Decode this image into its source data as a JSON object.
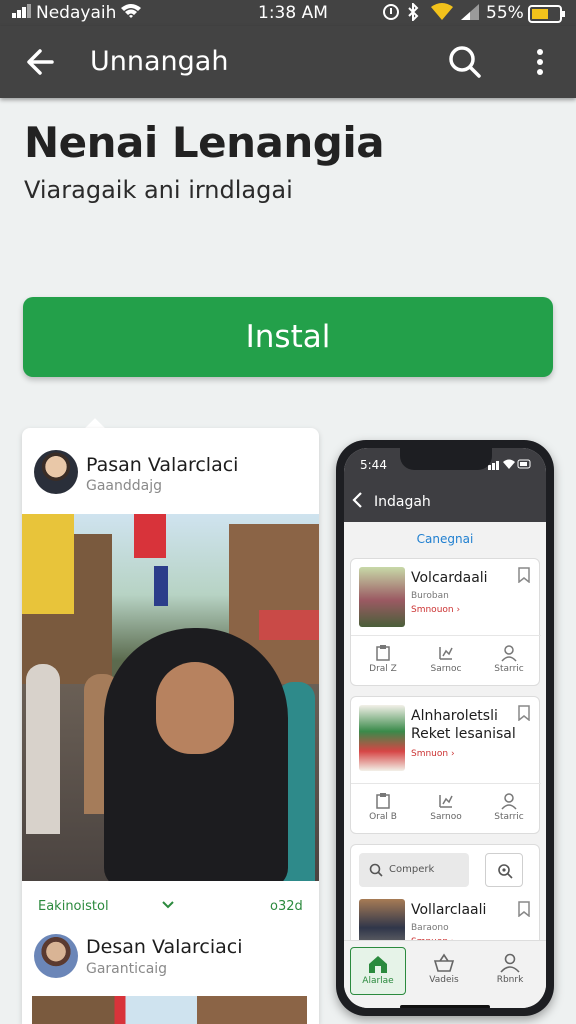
{
  "status_bar": {
    "carrier": "Nedayaih",
    "time": "1:38 AM",
    "battery": "55%"
  },
  "app_bar": {
    "title": "Unnangah",
    "icons": [
      "back-arrow-icon",
      "search-icon",
      "more-vert-icon"
    ]
  },
  "hero": {
    "title": "Nenai Lenangia",
    "subtitle": "Viaragaik ani irndlagai"
  },
  "install_button": {
    "label": "Instal",
    "color": "#23a04a"
  },
  "feed": {
    "posts": [
      {
        "name": "Pasan Valarclaci",
        "handle": "Gaanddajg"
      },
      {
        "name": "Desan Valarciaci",
        "handle": "Garanticaig"
      }
    ],
    "meta": {
      "left": "Eakinoistol",
      "right": "o32d"
    }
  },
  "phone": {
    "time": "5:44",
    "title": "Indagah",
    "category": "Canegnai",
    "cards": [
      {
        "title": "Volcardaali",
        "subtitle": "Buroban",
        "link": "Smnouon ›",
        "actions": [
          "Dral Z",
          "Sarnoc",
          "Starric"
        ]
      },
      {
        "title": "Alnharoletsli Reket lesanisal",
        "subtitle": "",
        "link": "Smnuon ›",
        "actions": [
          "Oral B",
          "Sarnoo",
          "Starric"
        ]
      },
      {
        "title": "Vollarclaali",
        "subtitle": "Baraono",
        "link": "Smnuon ›"
      }
    ],
    "search_label": "Comperk",
    "nav": [
      "Alarlae",
      "Vadeis",
      "Rbnrk"
    ]
  }
}
